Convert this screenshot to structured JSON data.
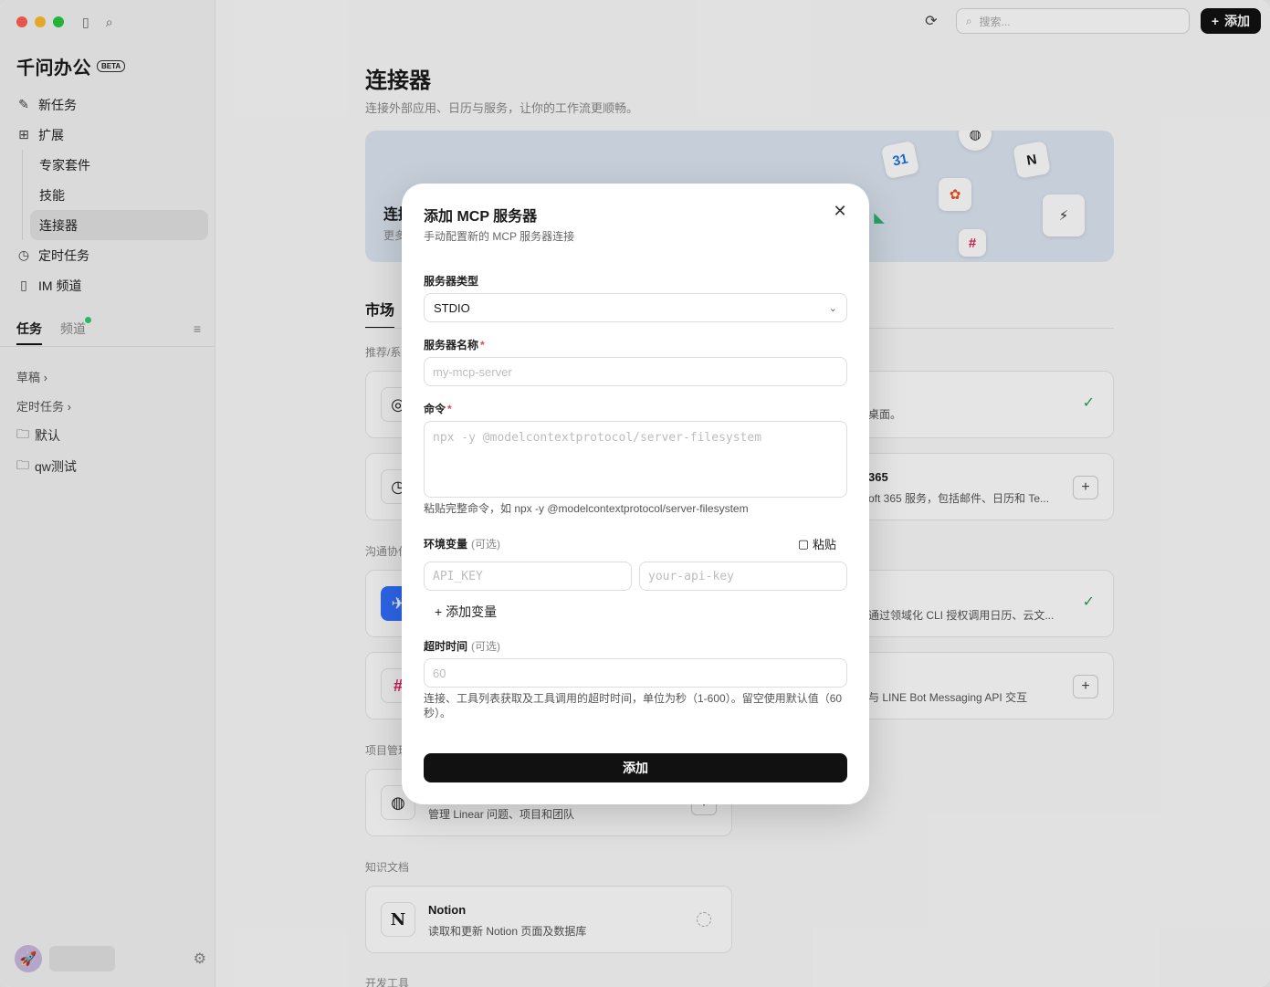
{
  "sidebar": {
    "brand": "千问办公",
    "beta": "BETA",
    "nav": [
      {
        "label": "新任务"
      },
      {
        "label": "扩展"
      },
      {
        "label": "专家套件"
      },
      {
        "label": "技能"
      },
      {
        "label": "连接器"
      },
      {
        "label": "定时任务"
      },
      {
        "label": "IM 频道"
      }
    ],
    "tabs": {
      "tasks": "任务",
      "channels": "频道"
    },
    "list": [
      {
        "label": "草稿 ›"
      },
      {
        "label": "定时任务 ›"
      },
      {
        "label": "默认"
      },
      {
        "label": "qw测试"
      }
    ]
  },
  "topbar": {
    "search_placeholder": "搜索...",
    "add_label": "添加"
  },
  "main": {
    "title": "连接器",
    "subtitle": "连接外部应用、日历与服务，让你的工作流更顺畅。",
    "banner_title": "连接",
    "banner_sub": "更多",
    "market_tab": "市场",
    "sections": {
      "recommended": "推荐/系",
      "communication": "沟通协作",
      "project": "项目管理",
      "knowledge": "知识文档",
      "dev": "开发工具"
    },
    "cards": {
      "right1_desc": "桌面。",
      "right2_name": "365",
      "right2_desc": "oft 365 服务，包括邮件、日历和 Te...",
      "right3_desc": "通过领域化 CLI 授权调用日历、云文...",
      "right4_desc": "与 LINE Bot Messaging API 交互",
      "linear_desc": "管理 Linear 问题、项目和团队",
      "notion_name": "Notion",
      "notion_desc": "读取和更新 Notion 页面及数据库"
    }
  },
  "modal": {
    "title": "添加 MCP 服务器",
    "subtitle": "手动配置新的 MCP 服务器连接",
    "server_type_label": "服务器类型",
    "server_type_value": "STDIO",
    "server_name_label": "服务器名称",
    "server_name_placeholder": "my-mcp-server",
    "command_label": "命令",
    "command_placeholder": "npx -y @modelcontextprotocol/server-filesystem",
    "command_help": "粘贴完整命令，如 npx -y @modelcontextprotocol/server-filesystem",
    "env_label": "环境变量",
    "optional": "(可选)",
    "paste_label": "粘贴",
    "env_key_placeholder": "API_KEY",
    "env_value_placeholder": "your-api-key",
    "add_var_label": "添加变量",
    "timeout_label": "超时时间",
    "timeout_placeholder": "60",
    "timeout_help": "连接、工具列表获取及工具调用的超时时间，单位为秒（1-600）。留空使用默认值（60秒）。",
    "submit_label": "添加",
    "required_mark": "*"
  },
  "colors": {
    "accent": "#111111",
    "required": "#e5484d",
    "connected": "#2e9d55",
    "banner_bg": "#dde7f2"
  }
}
